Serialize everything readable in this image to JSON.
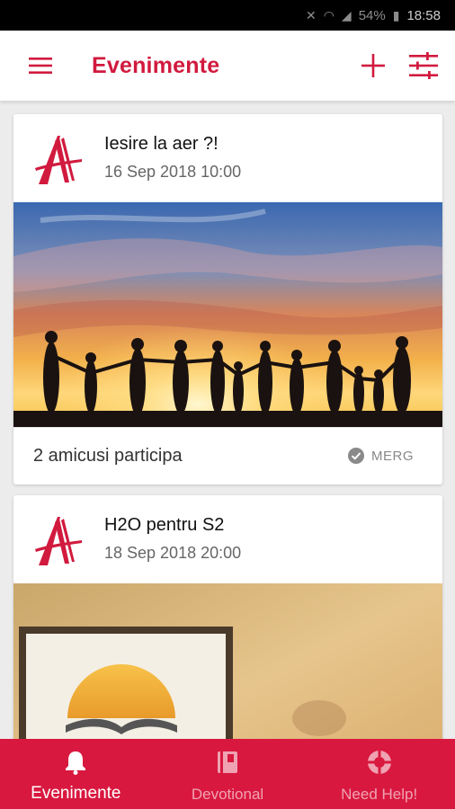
{
  "status_bar": {
    "battery": "54%",
    "time": "18:58"
  },
  "header": {
    "title": "Evenimente"
  },
  "events": [
    {
      "title": "Iesire la aer ?!",
      "date": "16 Sep 2018 10:00",
      "participants": "2 amicusi participa",
      "rsvp_label": "MERG"
    },
    {
      "title": "H2O pentru S2",
      "date": "18 Sep 2018 20:00"
    }
  ],
  "bottom_nav": [
    {
      "label": "Evenimente",
      "icon": "bell-icon",
      "active": true
    },
    {
      "label": "Devotional",
      "icon": "book-icon",
      "active": false
    },
    {
      "label": "Need Help!",
      "icon": "lifebuoy-icon",
      "active": false
    }
  ],
  "colors": {
    "brand": "#d11a3e",
    "nav_bg": "#d9183f",
    "background": "#ececec"
  }
}
